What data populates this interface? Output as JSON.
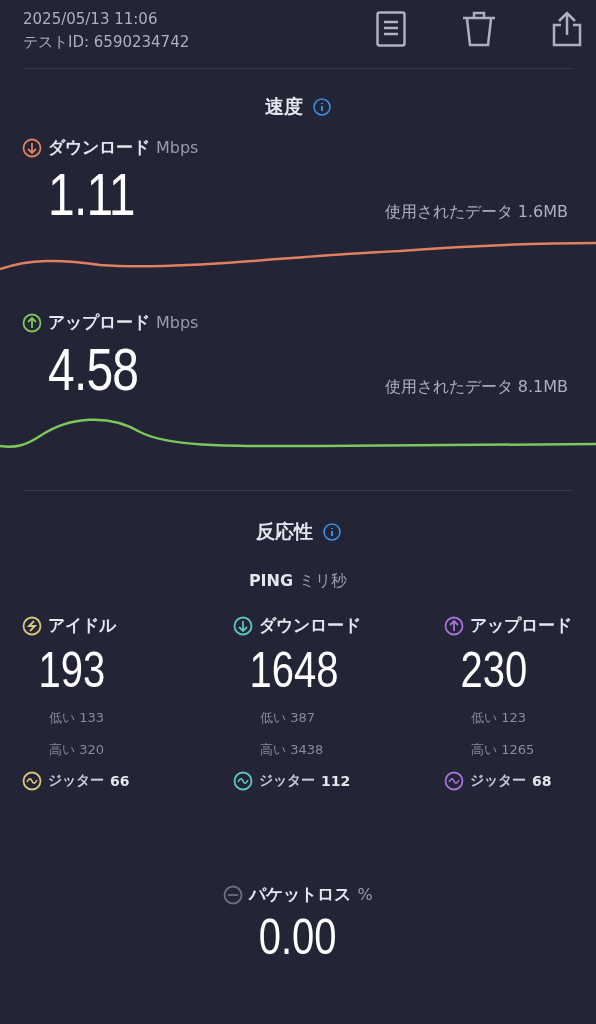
{
  "header": {
    "datetime": "2025/05/13 11:06",
    "test_id": "テストID: 6590234742"
  },
  "speed": {
    "title": "速度",
    "items": [
      {
        "kind": "download",
        "label": "ダウンロード",
        "unit": "Mbps",
        "value": "1.11",
        "data_used": "使用されたデータ 1.6MB",
        "color": "#e0805e"
      },
      {
        "kind": "upload",
        "label": "アップロード",
        "unit": "Mbps",
        "value": "4.58",
        "data_used": "使用されたデータ 8.1MB",
        "color": "#7cc75a"
      }
    ]
  },
  "responsiveness": {
    "title": "反応性",
    "ping_label": "PING",
    "ping_unit": "ミリ秒",
    "columns": [
      {
        "kind": "idle",
        "label": "アイドル",
        "value": "193",
        "low": "低い 133",
        "high": "高い 320",
        "jitter_label": "ジッター",
        "jitter": "66",
        "color": "#d9c878"
      },
      {
        "kind": "download",
        "label": "ダウンロード",
        "value": "1648",
        "low": "低い 387",
        "high": "高い 3438",
        "jitter_label": "ジッター",
        "jitter": "112",
        "color": "#5cc6c2"
      },
      {
        "kind": "upload",
        "label": "アップロード",
        "value": "230",
        "low": "低い 123",
        "high": "高い 1265",
        "jitter_label": "ジッター",
        "jitter": "68",
        "color": "#a970d8"
      }
    ]
  },
  "packet_loss": {
    "label": "パケットロス",
    "unit": "%",
    "value": "0.00"
  }
}
